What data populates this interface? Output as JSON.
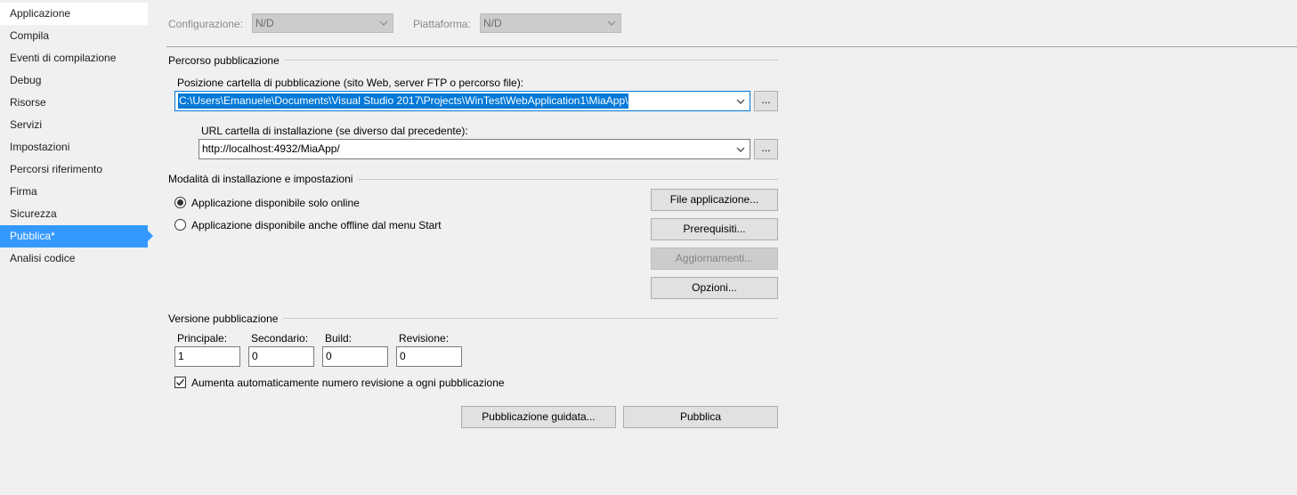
{
  "sidebar": {
    "items": [
      {
        "label": "Applicazione"
      },
      {
        "label": "Compila"
      },
      {
        "label": "Eventi di compilazione"
      },
      {
        "label": "Debug"
      },
      {
        "label": "Risorse"
      },
      {
        "label": "Servizi"
      },
      {
        "label": "Impostazioni"
      },
      {
        "label": "Percorsi riferimento"
      },
      {
        "label": "Firma"
      },
      {
        "label": "Sicurezza"
      },
      {
        "label": "Pubblica*"
      },
      {
        "label": "Analisi codice"
      }
    ],
    "active_index": 10
  },
  "config": {
    "configuration_label": "Configurazione:",
    "configuration_value": "N/D",
    "platform_label": "Piattaforma:",
    "platform_value": "N/D"
  },
  "publish_path": {
    "group_title": "Percorso pubblicazione",
    "folder_label": "Posizione cartella di pubblicazione (sito Web, server FTP o percorso file):",
    "folder_value": "C:\\Users\\Emanuele\\Documents\\Visual Studio 2017\\Projects\\WinTest\\WebApplication1\\MiaApp\\",
    "browse_label": "...",
    "install_url_label": "URL cartella di installazione (se diverso dal precedente):",
    "install_url_value": "http://localhost:4932/MiaApp/",
    "browse2_label": "..."
  },
  "install_mode": {
    "group_title": "Modalità di installazione e impostazioni",
    "option_online": "Applicazione disponibile solo online",
    "option_offline": "Applicazione disponibile anche offline dal menu Start",
    "selected": "online",
    "buttons": {
      "files": "File applicazione...",
      "prereq": "Prerequisiti...",
      "updates": "Aggiornamenti...",
      "options": "Opzioni..."
    }
  },
  "version": {
    "group_title": "Versione pubblicazione",
    "major_label": "Principale:",
    "major_value": "1",
    "minor_label": "Secondario:",
    "minor_value": "0",
    "build_label": "Build:",
    "build_value": "0",
    "revision_label": "Revisione:",
    "revision_value": "0",
    "auto_increment_label": "Aumenta automaticamente numero revisione a ogni pubblicazione",
    "auto_increment_checked": true
  },
  "actions": {
    "wizard": "Pubblicazione guidata...",
    "publish": "Pubblica"
  }
}
